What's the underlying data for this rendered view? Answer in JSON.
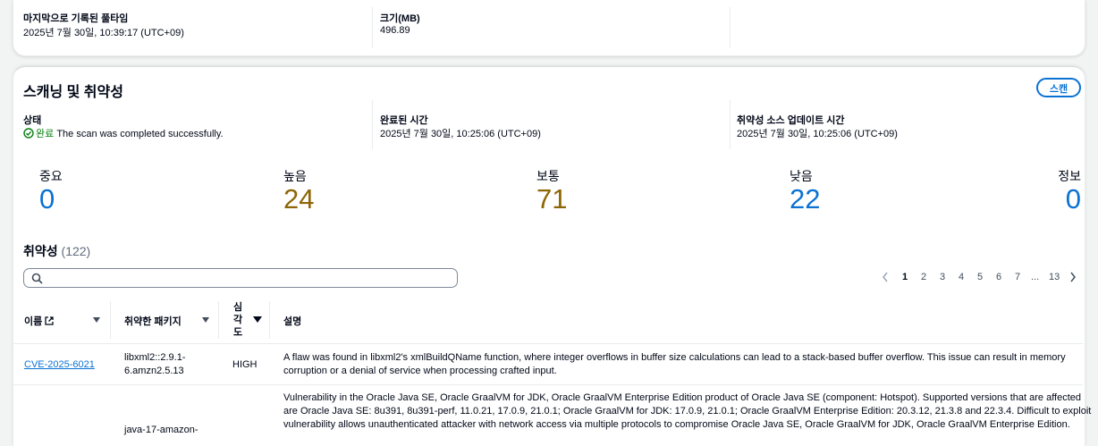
{
  "top_details": {
    "last_recorded_label": "마지막으로 기록된 풀타임",
    "last_recorded_value": "2025년 7월 30일, 10:39:17 (UTC+09)",
    "size_label": "크기(MB)",
    "size_value": "496.89"
  },
  "scanning": {
    "title": "스캐닝 및 취약성",
    "scan_button": "스캔",
    "status_label": "상태",
    "status_state": "완료",
    "status_message": "The scan was completed successfully.",
    "completed_label": "완료된 시간",
    "completed_value": "2025년 7월 30일, 10:25:06 (UTC+09)",
    "source_updated_label": "취약성 소스 업데이트 시간",
    "source_updated_value": "2025년 7월 30일, 10:25:06 (UTC+09)"
  },
  "severity": {
    "critical": {
      "label": "중요",
      "count": "0"
    },
    "high": {
      "label": "높음",
      "count": "24"
    },
    "medium": {
      "label": "보통",
      "count": "71"
    },
    "low": {
      "label": "낮음",
      "count": "22"
    },
    "info": {
      "label": "정보",
      "count": "0"
    }
  },
  "vulnerabilities": {
    "title": "취약성",
    "count": "(122)",
    "search_placeholder": "",
    "pagination": [
      "1",
      "2",
      "3",
      "4",
      "5",
      "6",
      "7",
      "...",
      "13"
    ],
    "current_page": "1",
    "columns": {
      "name": "이름",
      "package": "취약한 패키지",
      "severity_lines": [
        "심",
        "각",
        "도"
      ],
      "description": "설명"
    },
    "rows": [
      {
        "name": "CVE-2025-6021",
        "package_lines": [
          "libxml2::2.9.1-",
          "6.amzn2.5.13"
        ],
        "severity": "HIGH",
        "description_lines": [
          "A flaw was found in libxml2's xmlBuildQName function, where integer overflows in buffer size calculations can lead to a stack-based buffer overflow. This issue can result in memory",
          "corruption or a denial of service when processing crafted input."
        ]
      },
      {
        "name": "",
        "package_lines": [
          "java-17-amazon-"
        ],
        "severity": "",
        "description_lines": [
          "Vulnerability in the Oracle Java SE, Oracle GraalVM for JDK, Oracle GraalVM Enterprise Edition product of Oracle Java SE (component: Hotspot). Supported versions that are affected",
          "are Oracle Java SE: 8u391, 8u391-perf, 11.0.21, 17.0.9, 21.0.1; Oracle GraalVM for JDK: 17.0.9, 21.0.1; Oracle GraalVM Enterprise Edition: 20.3.12, 21.3.8 and 22.3.4. Difficult to exploit",
          "vulnerability allows unauthenticated attacker with network access via multiple protocols to compromise Oracle Java SE, Oracle GraalVM for JDK, Oracle GraalVM Enterprise Edition."
        ]
      }
    ]
  },
  "colors": {
    "accent": "#0972d3",
    "medium_high": "#8d6605",
    "success": "#037f0c"
  },
  "icons": [
    "search-icon",
    "external-link-icon",
    "sort-caret-icon",
    "success-check-icon",
    "chevron-left-icon",
    "chevron-right-icon"
  ]
}
